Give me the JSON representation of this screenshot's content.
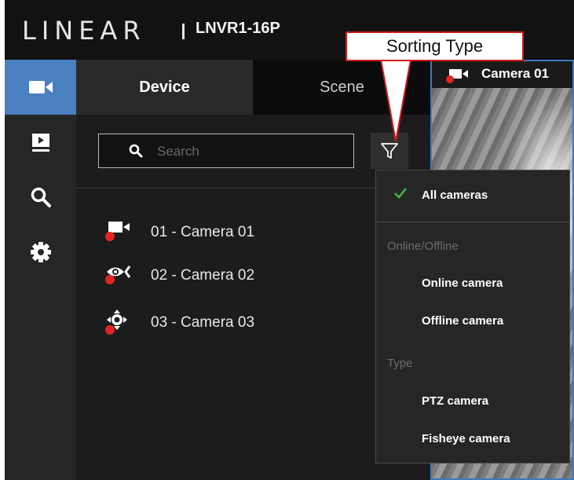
{
  "header": {
    "brand": "LINEAR",
    "model": "LNVR1-16P"
  },
  "sidebar": {
    "items": [
      {
        "name": "live-view",
        "icon": "video-camera-icon",
        "active": true
      },
      {
        "name": "playback",
        "icon": "playback-icon",
        "active": false
      },
      {
        "name": "search",
        "icon": "search-icon",
        "active": false
      },
      {
        "name": "settings",
        "icon": "gear-icon",
        "active": false
      }
    ]
  },
  "tabs": {
    "device": "Device",
    "scene": "Scene"
  },
  "search": {
    "placeholder": "Search",
    "value": ""
  },
  "devices": [
    {
      "label": "01 - Camera 01",
      "icon": "bullet-camera-icon",
      "status": "offline"
    },
    {
      "label": "02 - Camera 02",
      "icon": "fisheye-camera-icon",
      "status": "offline"
    },
    {
      "label": "03 - Camera 03",
      "icon": "ptz-camera-icon",
      "status": "offline"
    }
  ],
  "preview": {
    "title": "Camera 01"
  },
  "filter_menu": {
    "all": "All cameras",
    "section_status": "Online/Offline",
    "online": "Online camera",
    "offline": "Offline camera",
    "section_type": "Type",
    "ptz": "PTZ camera",
    "fisheye": "Fisheye camera"
  },
  "annotation": {
    "text": "Sorting Type"
  },
  "colors": {
    "accent": "#4a7fc0",
    "status_offline": "#e52525",
    "check": "#3fb93f",
    "callout_border": "#d01a1a"
  }
}
